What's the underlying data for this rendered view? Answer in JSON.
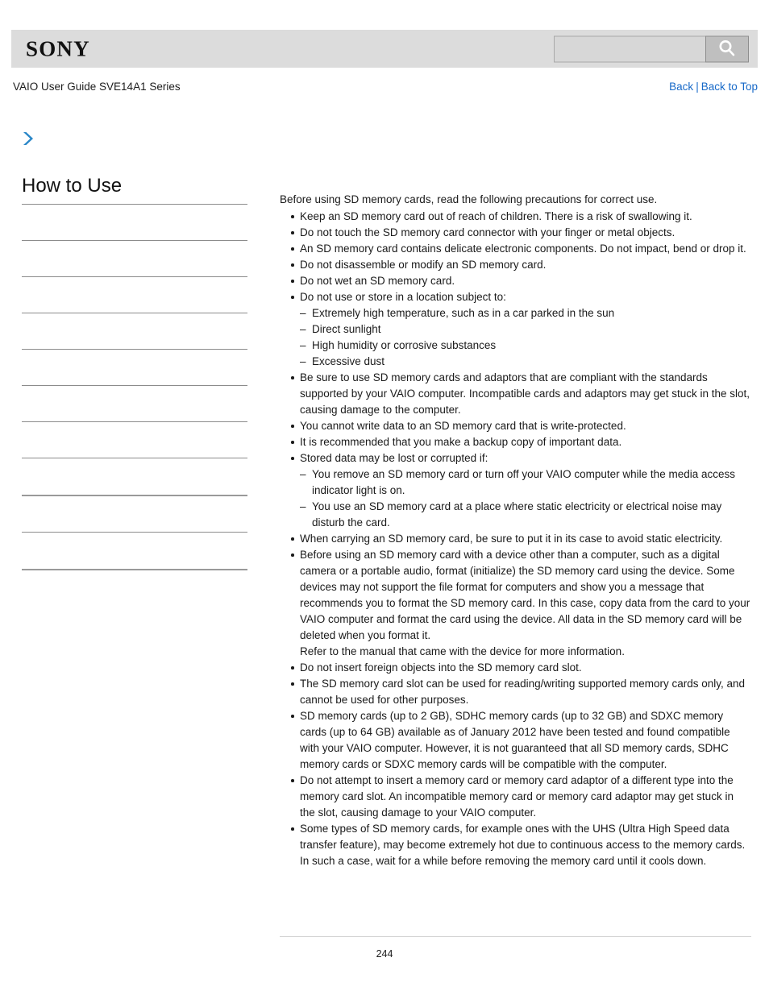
{
  "header": {
    "brand": "SONY",
    "search": {
      "value": "",
      "placeholder": "",
      "icon": "search-icon"
    }
  },
  "subheader": {
    "doc_title": "VAIO User Guide SVE14A1 Series",
    "links": {
      "back": "Back",
      "separator": "|",
      "back_to_top": "Back to Top"
    }
  },
  "sidebar": {
    "expand_icon": "chevron-right-icon",
    "title": "How to Use",
    "items": [
      "",
      "",
      "",
      "",
      "",
      "",
      "",
      "",
      "",
      ""
    ]
  },
  "main": {
    "intro": "Before using SD memory cards, read the following precautions for correct use.",
    "bullets": [
      {
        "text": "Keep an SD memory card out of reach of children. There is a risk of swallowing it."
      },
      {
        "text": "Do not touch the SD memory card connector with your finger or metal objects."
      },
      {
        "text": "An SD memory card contains delicate electronic components. Do not impact, bend or drop it."
      },
      {
        "text": "Do not disassemble or modify an SD memory card."
      },
      {
        "text": "Do not wet an SD memory card."
      },
      {
        "text": "Do not use or store in a location subject to:",
        "sub": [
          "Extremely high temperature, such as in a car parked in the sun",
          "Direct sunlight",
          "High humidity or corrosive substances",
          "Excessive dust"
        ]
      },
      {
        "text": "Be sure to use SD memory cards and adaptors that are compliant with the standards supported by your VAIO computer. Incompatible cards and adaptors may get stuck in the slot, causing damage to the computer."
      },
      {
        "text": "You cannot write data to an SD memory card that is write-protected."
      },
      {
        "text": "It is recommended that you make a backup copy of important data."
      },
      {
        "text": "Stored data may be lost or corrupted if:",
        "sub": [
          "You remove an SD memory card or turn off your VAIO computer while the media access indicator light is on.",
          "You use an SD memory card at a place where static electricity or electrical noise may disturb the card."
        ]
      },
      {
        "text": "When carrying an SD memory card, be sure to put it in its case to avoid static electricity."
      },
      {
        "text": "Before using an SD memory card with a device other than a computer, such as a digital camera or a portable audio, format (initialize) the SD memory card using the device. Some devices may not support the file format for computers and show you a message that recommends you to format the SD memory card. In this case, copy data from the card to your VAIO computer and format the card using the device. All data in the SD memory card will be deleted when you format it.",
        "extra": "Refer to the manual that came with the device for more information."
      },
      {
        "text": "Do not insert foreign objects into the SD memory card slot."
      },
      {
        "text": "The SD memory card slot can be used for reading/writing supported memory cards only, and cannot be used for other purposes."
      },
      {
        "text": "SD memory cards (up to 2 GB), SDHC memory cards (up to 32 GB) and SDXC memory cards (up to 64 GB) available as of January 2012 have been tested and found compatible with your VAIO computer. However, it is not guaranteed that all SD memory cards, SDHC memory cards or SDXC memory cards will be compatible with the computer."
      },
      {
        "text": "Do not attempt to insert a memory card or memory card adaptor of a different type into the memory card slot. An incompatible memory card or memory card adaptor may get stuck in the slot, causing damage to your VAIO computer."
      },
      {
        "text": "Some types of SD memory cards, for example ones with the UHS (Ultra High Speed data transfer feature), may become extremely hot due to continuous access to the memory cards. In such a case, wait for a while before removing the memory card until it cools down."
      }
    ]
  },
  "footer": {
    "page_number": "244"
  },
  "colors": {
    "link": "#1769c8",
    "header_band": "#dcdcdc",
    "chevron": "#2a87c8"
  }
}
